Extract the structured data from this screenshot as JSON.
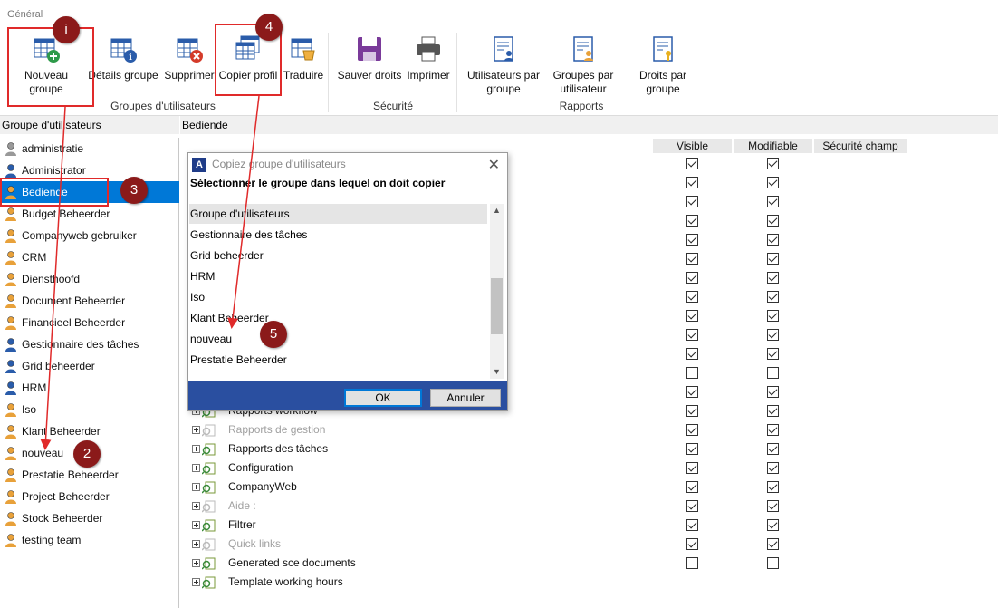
{
  "ribbon": {
    "title": "Général",
    "buttons": {
      "nouveau_groupe": "Nouveau groupe",
      "details_groupe": "Détails groupe",
      "supprimer": "Supprimer",
      "copier_profil": "Copier profil",
      "traduire": "Traduire",
      "sauver_droits": "Sauver droits",
      "imprimer": "Imprimer",
      "utilisateurs_par_groupe": "Utilisateurs par groupe",
      "groupes_par_utilisateur": "Groupes par utilisateur",
      "droits_par_groupe": "Droits par groupe"
    },
    "groups": {
      "groupes": "Groupes d'utilisateurs",
      "securite": "Sécurité",
      "rapports": "Rapports"
    }
  },
  "left_panel": {
    "header": "Groupe d'utilisateurs",
    "selected": "Bediende",
    "items": [
      {
        "label": "administratie",
        "icon": "user-gray-icon"
      },
      {
        "label": "Administrator",
        "icon": "user-blue-icon"
      },
      {
        "label": "Bediende",
        "icon": "user-orange-icon"
      },
      {
        "label": "Budget Beheerder",
        "icon": "user-orange-icon"
      },
      {
        "label": "Companyweb gebruiker",
        "icon": "user-orange-icon"
      },
      {
        "label": "CRM",
        "icon": "user-orange-icon"
      },
      {
        "label": "Diensthoofd",
        "icon": "user-orange-icon"
      },
      {
        "label": "Document Beheerder",
        "icon": "user-orange-icon"
      },
      {
        "label": "Financieel Beheerder",
        "icon": "user-orange-icon"
      },
      {
        "label": "Gestionnaire des tâches",
        "icon": "user-blue-icon"
      },
      {
        "label": "Grid beheerder",
        "icon": "user-blue-icon"
      },
      {
        "label": "HRM",
        "icon": "user-blue-icon"
      },
      {
        "label": "Iso",
        "icon": "user-orange-icon"
      },
      {
        "label": "Klant Beheerder",
        "icon": "user-orange-icon"
      },
      {
        "label": "nouveau",
        "icon": "user-orange-icon"
      },
      {
        "label": "Prestatie Beheerder",
        "icon": "user-orange-icon"
      },
      {
        "label": "Project Beheerder",
        "icon": "user-orange-icon"
      },
      {
        "label": "Stock Beheerder",
        "icon": "user-orange-icon"
      },
      {
        "label": "testing team",
        "icon": "user-orange-icon"
      }
    ]
  },
  "right_panel": {
    "header": "Bediende",
    "columns": {
      "visible": "Visible",
      "modifiable": "Modifiable",
      "securite_champ": "Sécurité champ"
    },
    "checkbox_rows": [
      {
        "visible": true,
        "modifiable": true
      },
      {
        "visible": true,
        "modifiable": true
      },
      {
        "visible": true,
        "modifiable": true
      },
      {
        "visible": true,
        "modifiable": true
      },
      {
        "visible": true,
        "modifiable": true
      },
      {
        "visible": true,
        "modifiable": true
      },
      {
        "visible": true,
        "modifiable": true
      },
      {
        "visible": true,
        "modifiable": true
      },
      {
        "visible": true,
        "modifiable": true
      },
      {
        "visible": true,
        "modifiable": true
      },
      {
        "visible": true,
        "modifiable": true
      },
      {
        "visible": false,
        "modifiable": false
      },
      {
        "visible": true,
        "modifiable": true
      },
      {
        "visible": true,
        "modifiable": true
      },
      {
        "visible": true,
        "modifiable": true
      },
      {
        "visible": true,
        "modifiable": true
      },
      {
        "visible": true,
        "modifiable": true
      },
      {
        "visible": true,
        "modifiable": true
      },
      {
        "visible": true,
        "modifiable": true
      },
      {
        "visible": true,
        "modifiable": true
      },
      {
        "visible": true,
        "modifiable": true
      },
      {
        "visible": false,
        "modifiable": false
      }
    ],
    "tree_rows": [
      {
        "label": "Rapports workflow",
        "dim": false
      },
      {
        "label": "Rapports de gestion",
        "dim": true
      },
      {
        "label": "Rapports des tâches",
        "dim": false
      },
      {
        "label": "Configuration",
        "dim": false
      },
      {
        "label": "CompanyWeb",
        "dim": false
      },
      {
        "label": "Aide :",
        "dim": true
      },
      {
        "label": "Filtrer",
        "dim": false
      },
      {
        "label": "Quick links",
        "dim": true
      },
      {
        "label": "Generated sce documents",
        "dim": false
      },
      {
        "label": "Template working hours",
        "dim": false
      }
    ]
  },
  "dialog": {
    "title": "Copiez groupe d'utilisateurs",
    "prompt": "Sélectionner le groupe dans lequel on doit copier",
    "items": [
      "Groupe d'utilisateurs",
      "Gestionnaire des tâches",
      "Grid beheerder",
      "HRM",
      "Iso",
      "Klant Beheerder",
      "nouveau",
      "Prestatie Beheerder"
    ],
    "ok": "OK",
    "cancel": "Annuler"
  },
  "badges": [
    "i",
    "2",
    "3",
    "4",
    "5"
  ],
  "colors": {
    "selection": "#0078d7",
    "badge": "#8b1a1a",
    "annotation": "#e02a2a",
    "dialog_footer": "#2a4fa0"
  }
}
